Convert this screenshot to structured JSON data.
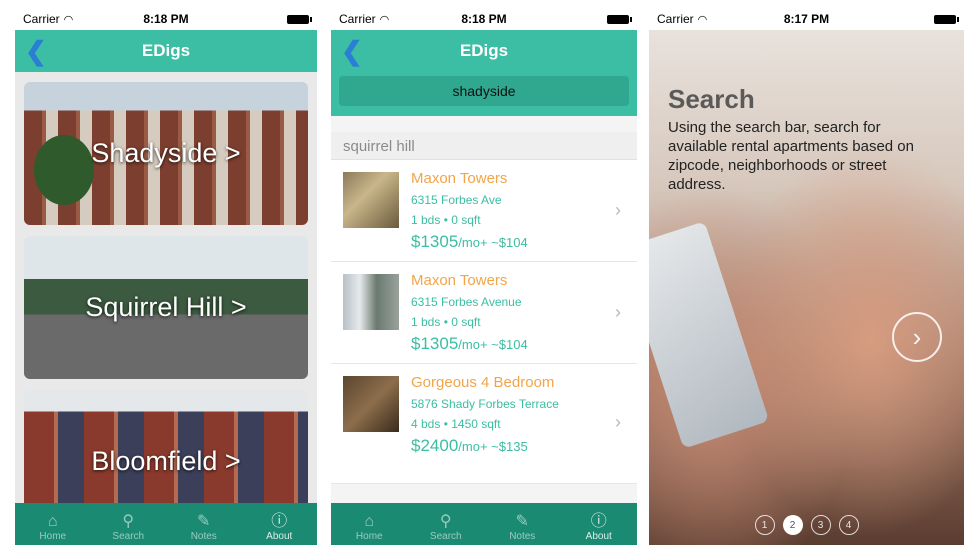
{
  "screen1": {
    "status": {
      "carrier": "Carrier",
      "time": "8:18 PM"
    },
    "nav": {
      "title": "EDigs",
      "back_glyph": "❮"
    },
    "cards": [
      {
        "label": "Shadyside >"
      },
      {
        "label": "Squirrel Hill >"
      },
      {
        "label": "Bloomfield >"
      }
    ]
  },
  "screen2": {
    "status": {
      "carrier": "Carrier",
      "time": "8:18 PM"
    },
    "nav": {
      "title": "EDigs",
      "back_glyph": "❮"
    },
    "search": {
      "value": "shadyside"
    },
    "section": "squirrel hill",
    "listings": [
      {
        "name": "Maxon Towers",
        "address": "6315 Forbes Ave",
        "details": "1 bds • 0 sqft",
        "price": "$1305",
        "price_suffix": "/mo+ ~$104"
      },
      {
        "name": "Maxon Towers",
        "address": "6315 Forbes Avenue",
        "details": "1 bds • 0 sqft",
        "price": "$1305",
        "price_suffix": "/mo+ ~$104"
      },
      {
        "name": "Gorgeous 4 Bedroom",
        "address": "5876 Shady Forbes Terrace",
        "details": "4 bds • 1450 sqft",
        "price": "$2400",
        "price_suffix": "/mo+ ~$135"
      }
    ]
  },
  "screen3": {
    "status": {
      "carrier": "Carrier",
      "time": "8:17 PM"
    },
    "title": "Search",
    "description": "Using the search bar, search for available rental apartments based on zipcode, neighborhoods or street address.",
    "pages": [
      "1",
      "2",
      "3",
      "4"
    ],
    "active_page": 2
  },
  "tabs": [
    {
      "label": "Home",
      "icon": "home-icon"
    },
    {
      "label": "Search",
      "icon": "search-icon"
    },
    {
      "label": "Notes",
      "icon": "pencil-icon"
    },
    {
      "label": "About",
      "icon": "info-icon"
    }
  ],
  "colors": {
    "teal": "#3bbea3",
    "tab_bar": "#1b8a72",
    "orange": "#f2a54a",
    "back_blue": "#2a7fd4"
  }
}
